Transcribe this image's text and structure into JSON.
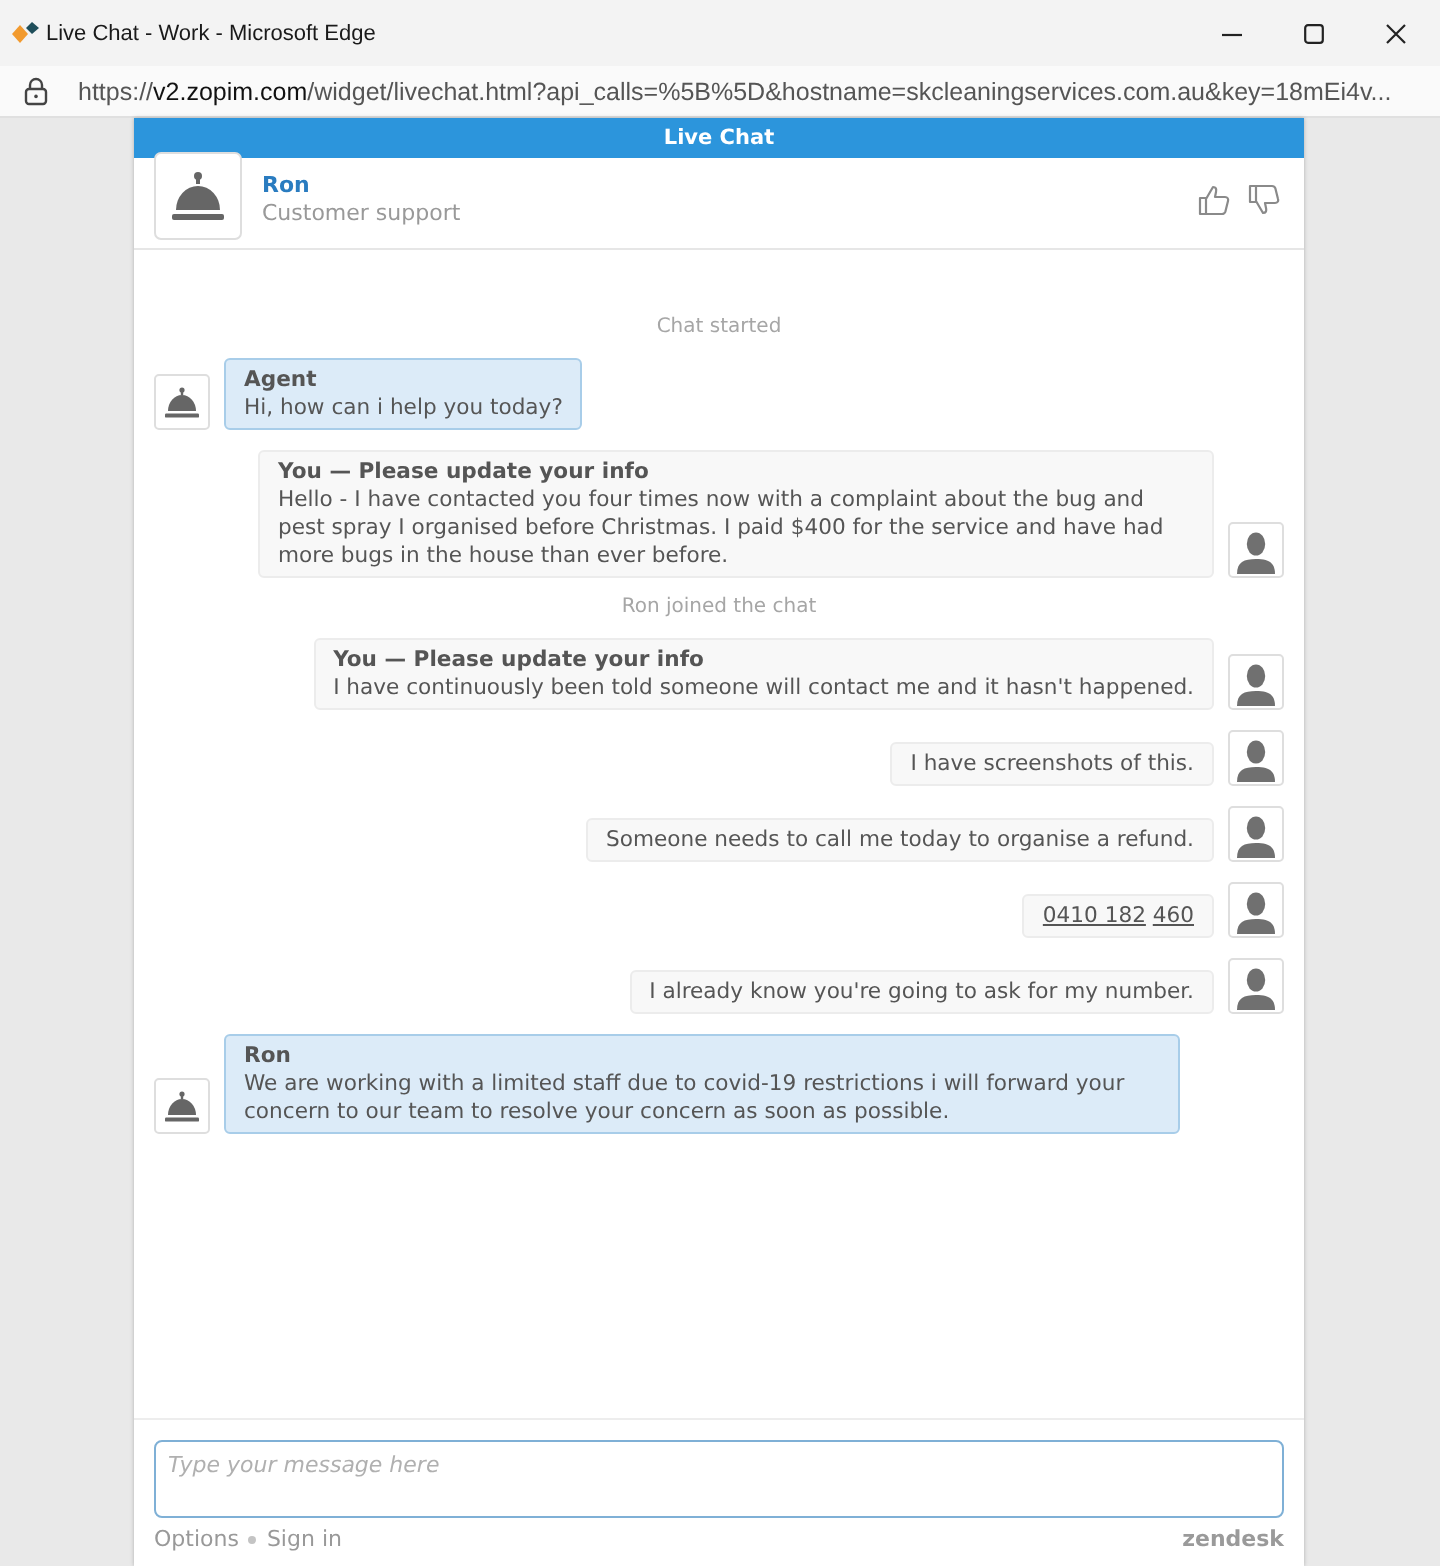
{
  "window": {
    "title": "Live Chat - Work - Microsoft Edge"
  },
  "address_bar": {
    "scheme": "https://",
    "host": "v2.zopim.com",
    "rest": "/widget/livechat.html?api_calls=%5B%5D&hostname=skcleaningservices.com.au&key=18mEi4v..."
  },
  "widget": {
    "title": "Live Chat",
    "agent_name": "Ron",
    "agent_role": "Customer support"
  },
  "messages": [
    {
      "kind": "system",
      "text": "Chat started"
    },
    {
      "kind": "agent",
      "name": "Agent",
      "text": "Hi, how can i help you today?"
    },
    {
      "kind": "visitor",
      "name": "You — Please update your info",
      "text": "Hello - I have contacted you four times now with a complaint about the bug and pest spray I organised before Christmas. I paid $400 for the service and have had more bugs in the house than ever before."
    },
    {
      "kind": "system",
      "text": "Ron joined the chat"
    },
    {
      "kind": "visitor",
      "name": "You — Please update your info",
      "text": "I have continuously been told someone will contact me and it hasn't happened."
    },
    {
      "kind": "visitor",
      "text": "I have screenshots of this."
    },
    {
      "kind": "visitor",
      "text": "Someone needs to call me today to organise a refund."
    },
    {
      "kind": "visitor",
      "links": [
        "0410 182",
        "460"
      ]
    },
    {
      "kind": "visitor",
      "text": "I already know you're going to ask for my number."
    },
    {
      "kind": "agent",
      "name": "Ron",
      "text": "We are working with a limited staff due to covid-19 restrictions i will forward your concern to our team to resolve your concern as soon as possible."
    }
  ],
  "composer": {
    "placeholder": "Type your message here"
  },
  "footer": {
    "links": [
      "Options",
      "Sign in"
    ],
    "brand": "zendesk"
  }
}
